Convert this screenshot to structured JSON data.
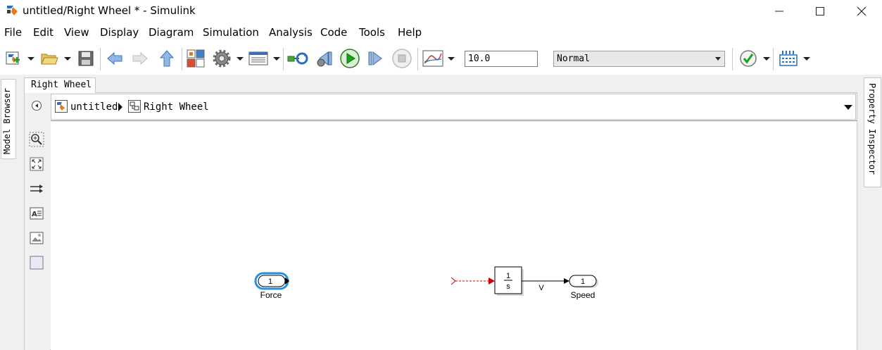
{
  "window": {
    "title": "untitled/Right Wheel * - Simulink"
  },
  "menu": {
    "items": [
      {
        "label": "File"
      },
      {
        "label": "Edit"
      },
      {
        "label": "View"
      },
      {
        "label": "Display"
      },
      {
        "label": "Diagram"
      },
      {
        "label": "Simulation"
      },
      {
        "label": "Analysis"
      },
      {
        "label": "Code"
      },
      {
        "label": "Tools"
      },
      {
        "label": "Help"
      }
    ]
  },
  "toolbar": {
    "stop_time": "10.0",
    "sim_mode": "Normal",
    "icons": [
      "new-model-icon",
      "open-folder-icon",
      "save-icon",
      "back-icon",
      "forward-icon",
      "up-icon",
      "library-browser-icon",
      "settings-gear-icon",
      "model-explorer-icon",
      "update-diagram-icon",
      "step-back-icon",
      "run-icon",
      "step-forward-icon",
      "stop-icon",
      "scope-icon",
      "check-icon",
      "build-icon"
    ]
  },
  "side_tabs": {
    "left": "Model Browser",
    "right": "Property Inspector"
  },
  "editor": {
    "tab_label": "Right Wheel",
    "breadcrumb": [
      "untitled",
      "Right Wheel"
    ]
  },
  "diagram": {
    "inport": {
      "number": "1",
      "name": "Force"
    },
    "integrator": {
      "numerator": "1",
      "denominator": "s"
    },
    "signal_label": "V",
    "outport": {
      "number": "1",
      "name": "Speed"
    }
  },
  "colors": {
    "accent_blue": "#2c8fdc",
    "unconnected_red": "#d10000",
    "run_green": "#1aa31a"
  }
}
